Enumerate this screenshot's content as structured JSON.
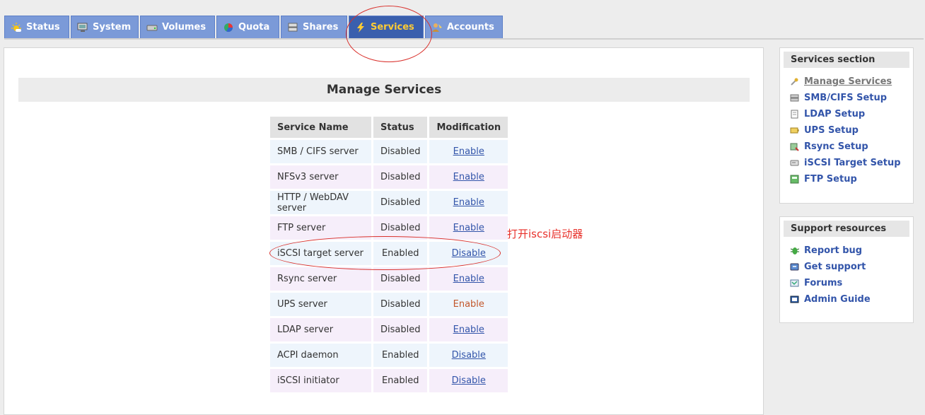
{
  "tabs": [
    {
      "label": "Status",
      "icon": "sun-icon",
      "active": false
    },
    {
      "label": "System",
      "icon": "monitor-icon",
      "active": false
    },
    {
      "label": "Volumes",
      "icon": "drive-icon",
      "active": false
    },
    {
      "label": "Quota",
      "icon": "pie-icon",
      "active": false
    },
    {
      "label": "Shares",
      "icon": "server-icon",
      "active": false
    },
    {
      "label": "Services",
      "icon": "lightning-icon",
      "active": true
    },
    {
      "label": "Accounts",
      "icon": "users-icon",
      "active": false
    }
  ],
  "main": {
    "title": "Manage Services",
    "table": {
      "headers": [
        "Service Name",
        "Status",
        "Modification"
      ],
      "rows": [
        {
          "name": "SMB / CIFS server",
          "status": "Disabled",
          "action": "Enable"
        },
        {
          "name": "NFSv3 server",
          "status": "Disabled",
          "action": "Enable"
        },
        {
          "name": "HTTP / WebDAV server",
          "status": "Disabled",
          "action": "Enable"
        },
        {
          "name": "FTP server",
          "status": "Disabled",
          "action": "Enable"
        },
        {
          "name": "iSCSI target server",
          "status": "Enabled",
          "action": "Disable"
        },
        {
          "name": "Rsync server",
          "status": "Disabled",
          "action": "Enable"
        },
        {
          "name": "UPS server",
          "status": "Disabled",
          "action": "Enable"
        },
        {
          "name": "LDAP server",
          "status": "Disabled",
          "action": "Enable"
        },
        {
          "name": "ACPI daemon",
          "status": "Enabled",
          "action": "Disable"
        },
        {
          "name": "iSCSI initiator",
          "status": "Enabled",
          "action": "Disable"
        }
      ]
    },
    "annotation": "打开iscsi启动器"
  },
  "services_section": {
    "title": "Services section",
    "items": [
      {
        "label": "Manage Services",
        "icon": "wrench-icon"
      },
      {
        "label": "SMB/CIFS Setup",
        "icon": "server-icon"
      },
      {
        "label": "LDAP Setup",
        "icon": "document-icon"
      },
      {
        "label": "UPS Setup",
        "icon": "battery-icon"
      },
      {
        "label": "Rsync Setup",
        "icon": "sync-icon"
      },
      {
        "label": "iSCSI Target Setup",
        "icon": "disk-icon"
      },
      {
        "label": "FTP Setup",
        "icon": "ftp-icon"
      }
    ]
  },
  "support": {
    "title": "Support resources",
    "items": [
      {
        "label": "Report bug",
        "icon": "bug-icon"
      },
      {
        "label": "Get support",
        "icon": "help-icon"
      },
      {
        "label": "Forums",
        "icon": "forum-icon"
      },
      {
        "label": "Admin Guide",
        "icon": "book-icon"
      }
    ]
  },
  "colors": {
    "tab": "#7b9ad8",
    "tab_active": "#3a5fad",
    "tab_active_text": "#ffcc33",
    "link": "#3355aa",
    "annotation": "#e8302a"
  }
}
